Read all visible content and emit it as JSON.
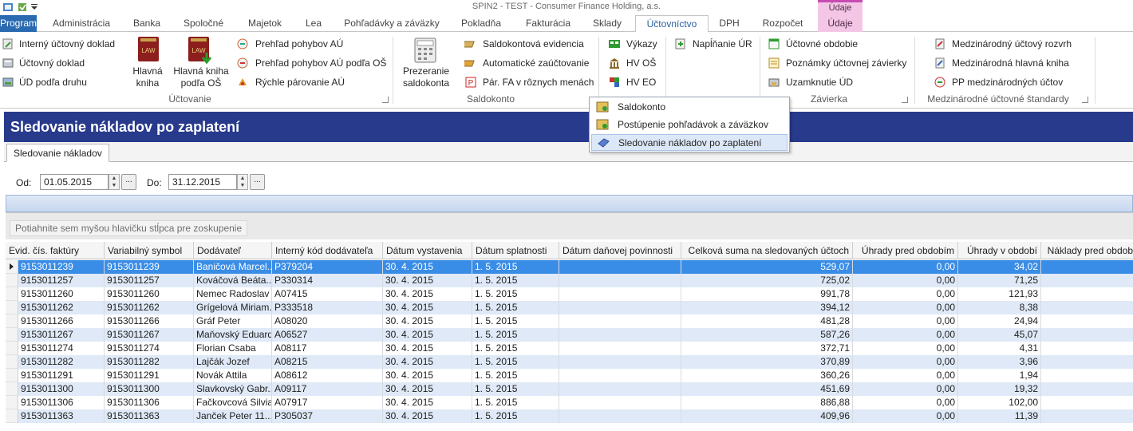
{
  "window": {
    "title": "SPIN2 - TEST - Consumer Finance Holding, a.s.",
    "context_header": "Údaje"
  },
  "ribbon_tabs": [
    {
      "label": "Program"
    },
    {
      "label": "Administrácia"
    },
    {
      "label": "Banka"
    },
    {
      "label": "Spoločné"
    },
    {
      "label": "Majetok"
    },
    {
      "label": "Lea"
    },
    {
      "label": "Pohľadávky a záväzky"
    },
    {
      "label": "Pokladňa"
    },
    {
      "label": "Fakturácia"
    },
    {
      "label": "Sklady"
    },
    {
      "label": "Účtovníctvo"
    },
    {
      "label": "DPH"
    },
    {
      "label": "Rozpočet"
    },
    {
      "label": "Údaje"
    }
  ],
  "ribbon": {
    "uctovanie": {
      "items": [
        "Interný účtovný doklad",
        "Účtovný doklad",
        "ÚD podľa druhu"
      ],
      "big1": "Hlavná kniha",
      "big2": "Hlavná kniha podľa OŠ",
      "items2": [
        "Prehľad pohybov AÚ",
        "Prehľad pohybov AÚ podľa OŠ",
        "Rýchle párovanie AÚ"
      ],
      "label": "Účtovanie"
    },
    "saldokonto": {
      "big": "Prezeranie saldokonta",
      "items": [
        "Saldokontová evidencia",
        "Automatické zaúčtovanie",
        "Pár. FA v rôznych menách"
      ],
      "label": "Saldokonto"
    },
    "vykazy": {
      "items": [
        "Výkazy",
        "HV OŠ",
        "HV EO"
      ]
    },
    "ur": {
      "items": [
        "Napĺňanie ÚR"
      ]
    },
    "zavierka": {
      "items": [
        "Účtovné obdobie",
        "Poznámky účtovnej závierky",
        "Uzamknutie ÚD"
      ],
      "label": "Závierka"
    },
    "mus": {
      "items": [
        "Medzinárodný účtový rozvrh",
        "Medzinárodná hlavná kniha",
        "PP medzinárodných účtov"
      ],
      "label": "Medzinárodné účtovné štandardy"
    }
  },
  "dropdown": {
    "items": [
      "Saldokonto",
      "Postúpenie pohľadávok a záväzkov",
      "Sledovanie nákladov po zaplatení"
    ],
    "highlighted_index": 2
  },
  "page": {
    "title": "Sledovanie nákladov po zaplatení",
    "subtab": "Sledovanie nákladov",
    "from_label": "Od:",
    "from_value": "01.05.2015",
    "to_label": "Do:",
    "to_value": "31.12.2015",
    "group_hint": "Potiahnite sem myšou hlavičku stĺpca pre zoskupenie"
  },
  "grid": {
    "columns": [
      "Evid. čís. faktúry",
      "Variabilný symbol",
      "Dodávateľ",
      "Interný kód dodávateľa",
      "Dátum vystavenia",
      "Dátum splatnosti",
      "Dátum daňovej povinnosti",
      "Celková suma na sledovaných účtoch",
      "Úhrady pred obdobím",
      "Úhrady v období",
      "Náklady pred obdob"
    ],
    "rows": [
      [
        "9153011239",
        "9153011239",
        "Baničová Marcel...",
        "P379204",
        "30. 4. 2015",
        "1. 5. 2015",
        "",
        "529,07",
        "0,00",
        "34,02"
      ],
      [
        "9153011257",
        "9153011257",
        "Kováčová Beáta...",
        "P330314",
        "30. 4. 2015",
        "1. 5. 2015",
        "",
        "725,02",
        "0,00",
        "71,25"
      ],
      [
        "9153011260",
        "9153011260",
        "Nemec Radoslav",
        "A07415",
        "30. 4. 2015",
        "1. 5. 2015",
        "",
        "991,78",
        "0,00",
        "121,93"
      ],
      [
        "9153011262",
        "9153011262",
        "Grígelová Miriam...",
        "P333518",
        "30. 4. 2015",
        "1. 5. 2015",
        "",
        "394,12",
        "0,00",
        "8,38"
      ],
      [
        "9153011266",
        "9153011266",
        "Gráf Peter",
        "A08020",
        "30. 4. 2015",
        "1. 5. 2015",
        "",
        "481,28",
        "0,00",
        "24,94"
      ],
      [
        "9153011267",
        "9153011267",
        "Maňovský Eduard",
        "A06527",
        "30. 4. 2015",
        "1. 5. 2015",
        "",
        "587,26",
        "0,00",
        "45,07"
      ],
      [
        "9153011274",
        "9153011274",
        "Florian Csaba",
        "A08117",
        "30. 4. 2015",
        "1. 5. 2015",
        "",
        "372,71",
        "0,00",
        "4,31"
      ],
      [
        "9153011282",
        "9153011282",
        "Lajčák Jozef",
        "A08215",
        "30. 4. 2015",
        "1. 5. 2015",
        "",
        "370,89",
        "0,00",
        "3,96"
      ],
      [
        "9153011291",
        "9153011291",
        "Novák Attila",
        "A08612",
        "30. 4. 2015",
        "1. 5. 2015",
        "",
        "360,26",
        "0,00",
        "1,94"
      ],
      [
        "9153011300",
        "9153011300",
        "Slavkovský Gabr...",
        "A09117",
        "30. 4. 2015",
        "1. 5. 2015",
        "",
        "451,69",
        "0,00",
        "19,32"
      ],
      [
        "9153011306",
        "9153011306",
        "Fačkovcová Silvia",
        "A07917",
        "30. 4. 2015",
        "1. 5. 2015",
        "",
        "886,88",
        "0,00",
        "102,00"
      ],
      [
        "9153011363",
        "9153011363",
        "Janček Peter 11...",
        "P305037",
        "30. 4. 2015",
        "1. 5. 2015",
        "",
        "409,96",
        "0,00",
        "11,39"
      ]
    ],
    "selected_row": 0
  },
  "colors": {
    "header_bg": "#283a8c",
    "row_alt": "#dfe9f7",
    "row_selected": "#3a8de6",
    "accent": "#2a6ab0"
  }
}
